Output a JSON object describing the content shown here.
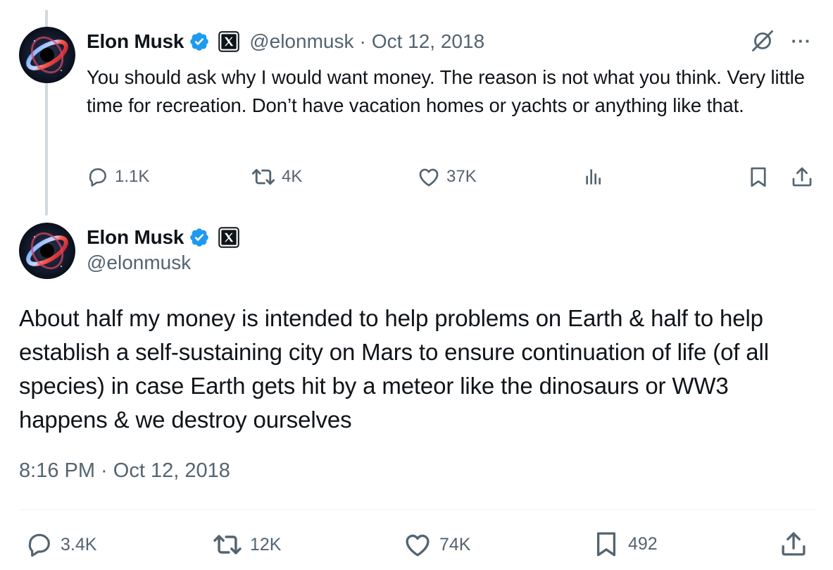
{
  "reply_tweet": {
    "author_name": "Elon Musk",
    "handle": "@elonmusk",
    "separator": "·",
    "date": "Oct 12, 2018",
    "text": "You should ask why I would want money. The reason is not what you think. Very little time for recreation. Don’t have vacation homes or yachts or anything like that.",
    "stats": {
      "replies": "1.1K",
      "retweets": "4K",
      "likes": "37K"
    }
  },
  "main_tweet": {
    "author_name": "Elon Musk",
    "handle": "@elonmusk",
    "text": "About half my money is intended to help problems on Earth & half to help establish a self-sustaining city on Mars to ensure continuation of life (of all species) in case Earth gets hit by a meteor like the dinosaurs or WW3 happens & we destroy ourselves",
    "timestamp": "8:16 PM · Oct 12, 2018",
    "stats": {
      "replies": "3.4K",
      "retweets": "12K",
      "likes": "74K",
      "bookmarks": "492"
    }
  },
  "colors": {
    "text": "#0f1419",
    "secondary": "#536471",
    "verified_blue": "#1d9bf0",
    "thread_line": "#cfd9de",
    "divider": "#eff3f4"
  },
  "icons": {
    "reply": "reply-icon",
    "retweet": "retweet-icon",
    "like": "heart-icon",
    "views": "views-icon",
    "bookmark": "bookmark-icon",
    "share": "share-icon",
    "grok": "grok-icon",
    "more": "more-icon",
    "verified": "verified-badge-icon",
    "affiliate": "x-logo-badge"
  }
}
